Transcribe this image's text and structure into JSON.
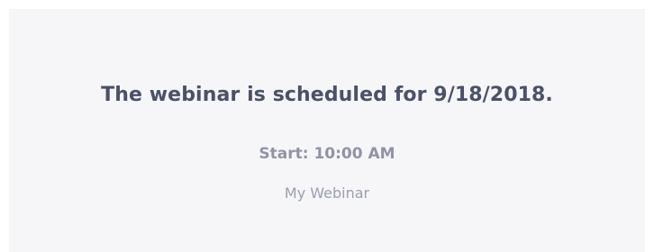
{
  "webinar": {
    "scheduled_message": "The webinar is scheduled for 9/18/2018.",
    "start_text": "Start: 10:00 AM",
    "name": "My Webinar"
  },
  "colors": {
    "panel_background": "#f6f6f9",
    "title_text": "#4a5168",
    "secondary_text": "#8f93a6"
  }
}
